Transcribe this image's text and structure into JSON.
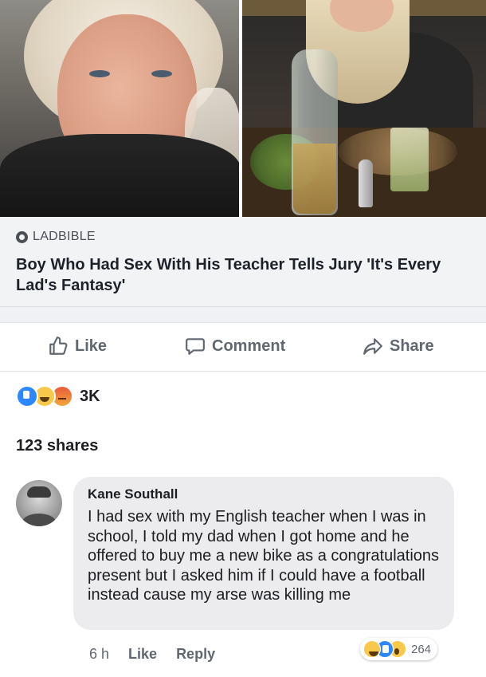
{
  "post": {
    "source": "LADBIBLE",
    "headline": "Boy Who Had Sex With His Teacher Tells Jury 'It's Every Lad's Fantasy'"
  },
  "actions": {
    "like": "Like",
    "comment": "Comment",
    "share": "Share"
  },
  "stats": {
    "reactions_count": "3K",
    "reaction_icons": [
      "like-icon",
      "haha-icon",
      "angry-icon"
    ],
    "shares": "123 shares"
  },
  "comment": {
    "author": "Kane Southall",
    "text": "I had sex with my English teacher when I was in school, I told my dad when I got home and he offered to buy me a new bike as a congratulations present but I asked him if I could have a football instead cause my arse was killing me",
    "time": "6 h",
    "like": "Like",
    "reply": "Reply",
    "reactions_count": "264",
    "reaction_icons": [
      "haha-icon",
      "like-icon",
      "wow-icon"
    ]
  },
  "colors": {
    "accent_like": "#2d88ff",
    "reaction_yellow": "#f7c84a",
    "text_secondary": "#606770"
  }
}
